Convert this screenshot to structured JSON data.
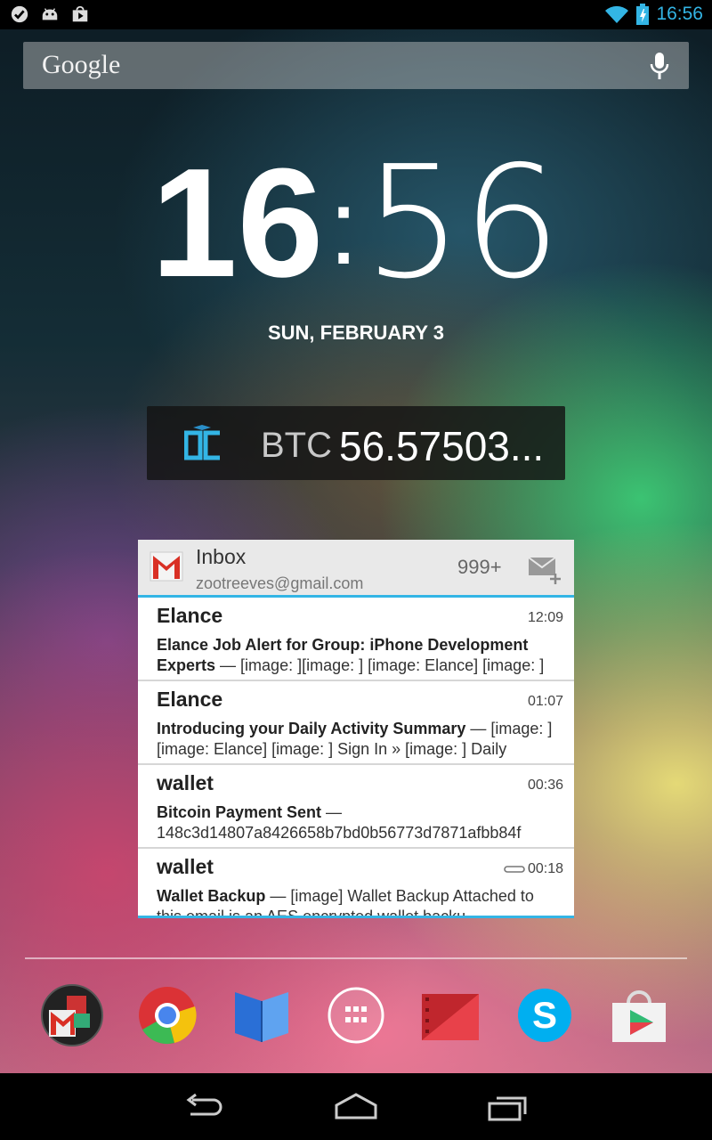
{
  "status_bar": {
    "time": "16:56",
    "left_icons": [
      "check-icon",
      "android-icon",
      "play-store-icon"
    ],
    "right_icons": [
      "wifi-icon",
      "battery-charging-icon"
    ],
    "accent": "#33b5e5"
  },
  "search": {
    "label": "Google",
    "mic_icon": "mic-icon"
  },
  "clock": {
    "hours": "16",
    "minutes": "56",
    "date": "SUN, FEBRUARY 3"
  },
  "btc_widget": {
    "label": "BTC",
    "value": "56.57503...",
    "logo_icon": "oc-logo-icon"
  },
  "gmail_widget": {
    "title": "Inbox",
    "account": "zootreeves@gmail.com",
    "count": "999+",
    "emails": [
      {
        "sender": "Elance",
        "time": "12:09",
        "subject": "Elance Job Alert  for Group: iPhone Development Experts",
        "snippet": " — [image: ][image: ] [image: Elance] [image: ]",
        "attachment": false
      },
      {
        "sender": "Elance",
        "time": "01:07",
        "subject": "Introducing your Daily Activity Summary",
        "snippet": " — [image: ] [image: Elance] [image: ] Sign In » [image: ] Daily",
        "attachment": false
      },
      {
        "sender": "wallet",
        "time": "00:36",
        "subject": "Bitcoin Payment Sent",
        "snippet": " — 148c3d14807a8426658b7bd0b56773d7871afbb84f",
        "attachment": false
      },
      {
        "sender": "wallet",
        "time": "00:18",
        "subject": "Wallet Backup",
        "snippet": " — [image] Wallet Backup Attached to this email is an AES encrypted wallet backu",
        "attachment": true
      }
    ]
  },
  "dock": {
    "apps": [
      "gmail-google-folder-icon",
      "chrome-icon",
      "play-books-icon",
      "app-drawer-icon",
      "play-movies-icon",
      "skype-icon",
      "play-store-icon"
    ]
  },
  "nav": {
    "buttons": [
      "back-icon",
      "home-icon",
      "recent-apps-icon"
    ]
  }
}
